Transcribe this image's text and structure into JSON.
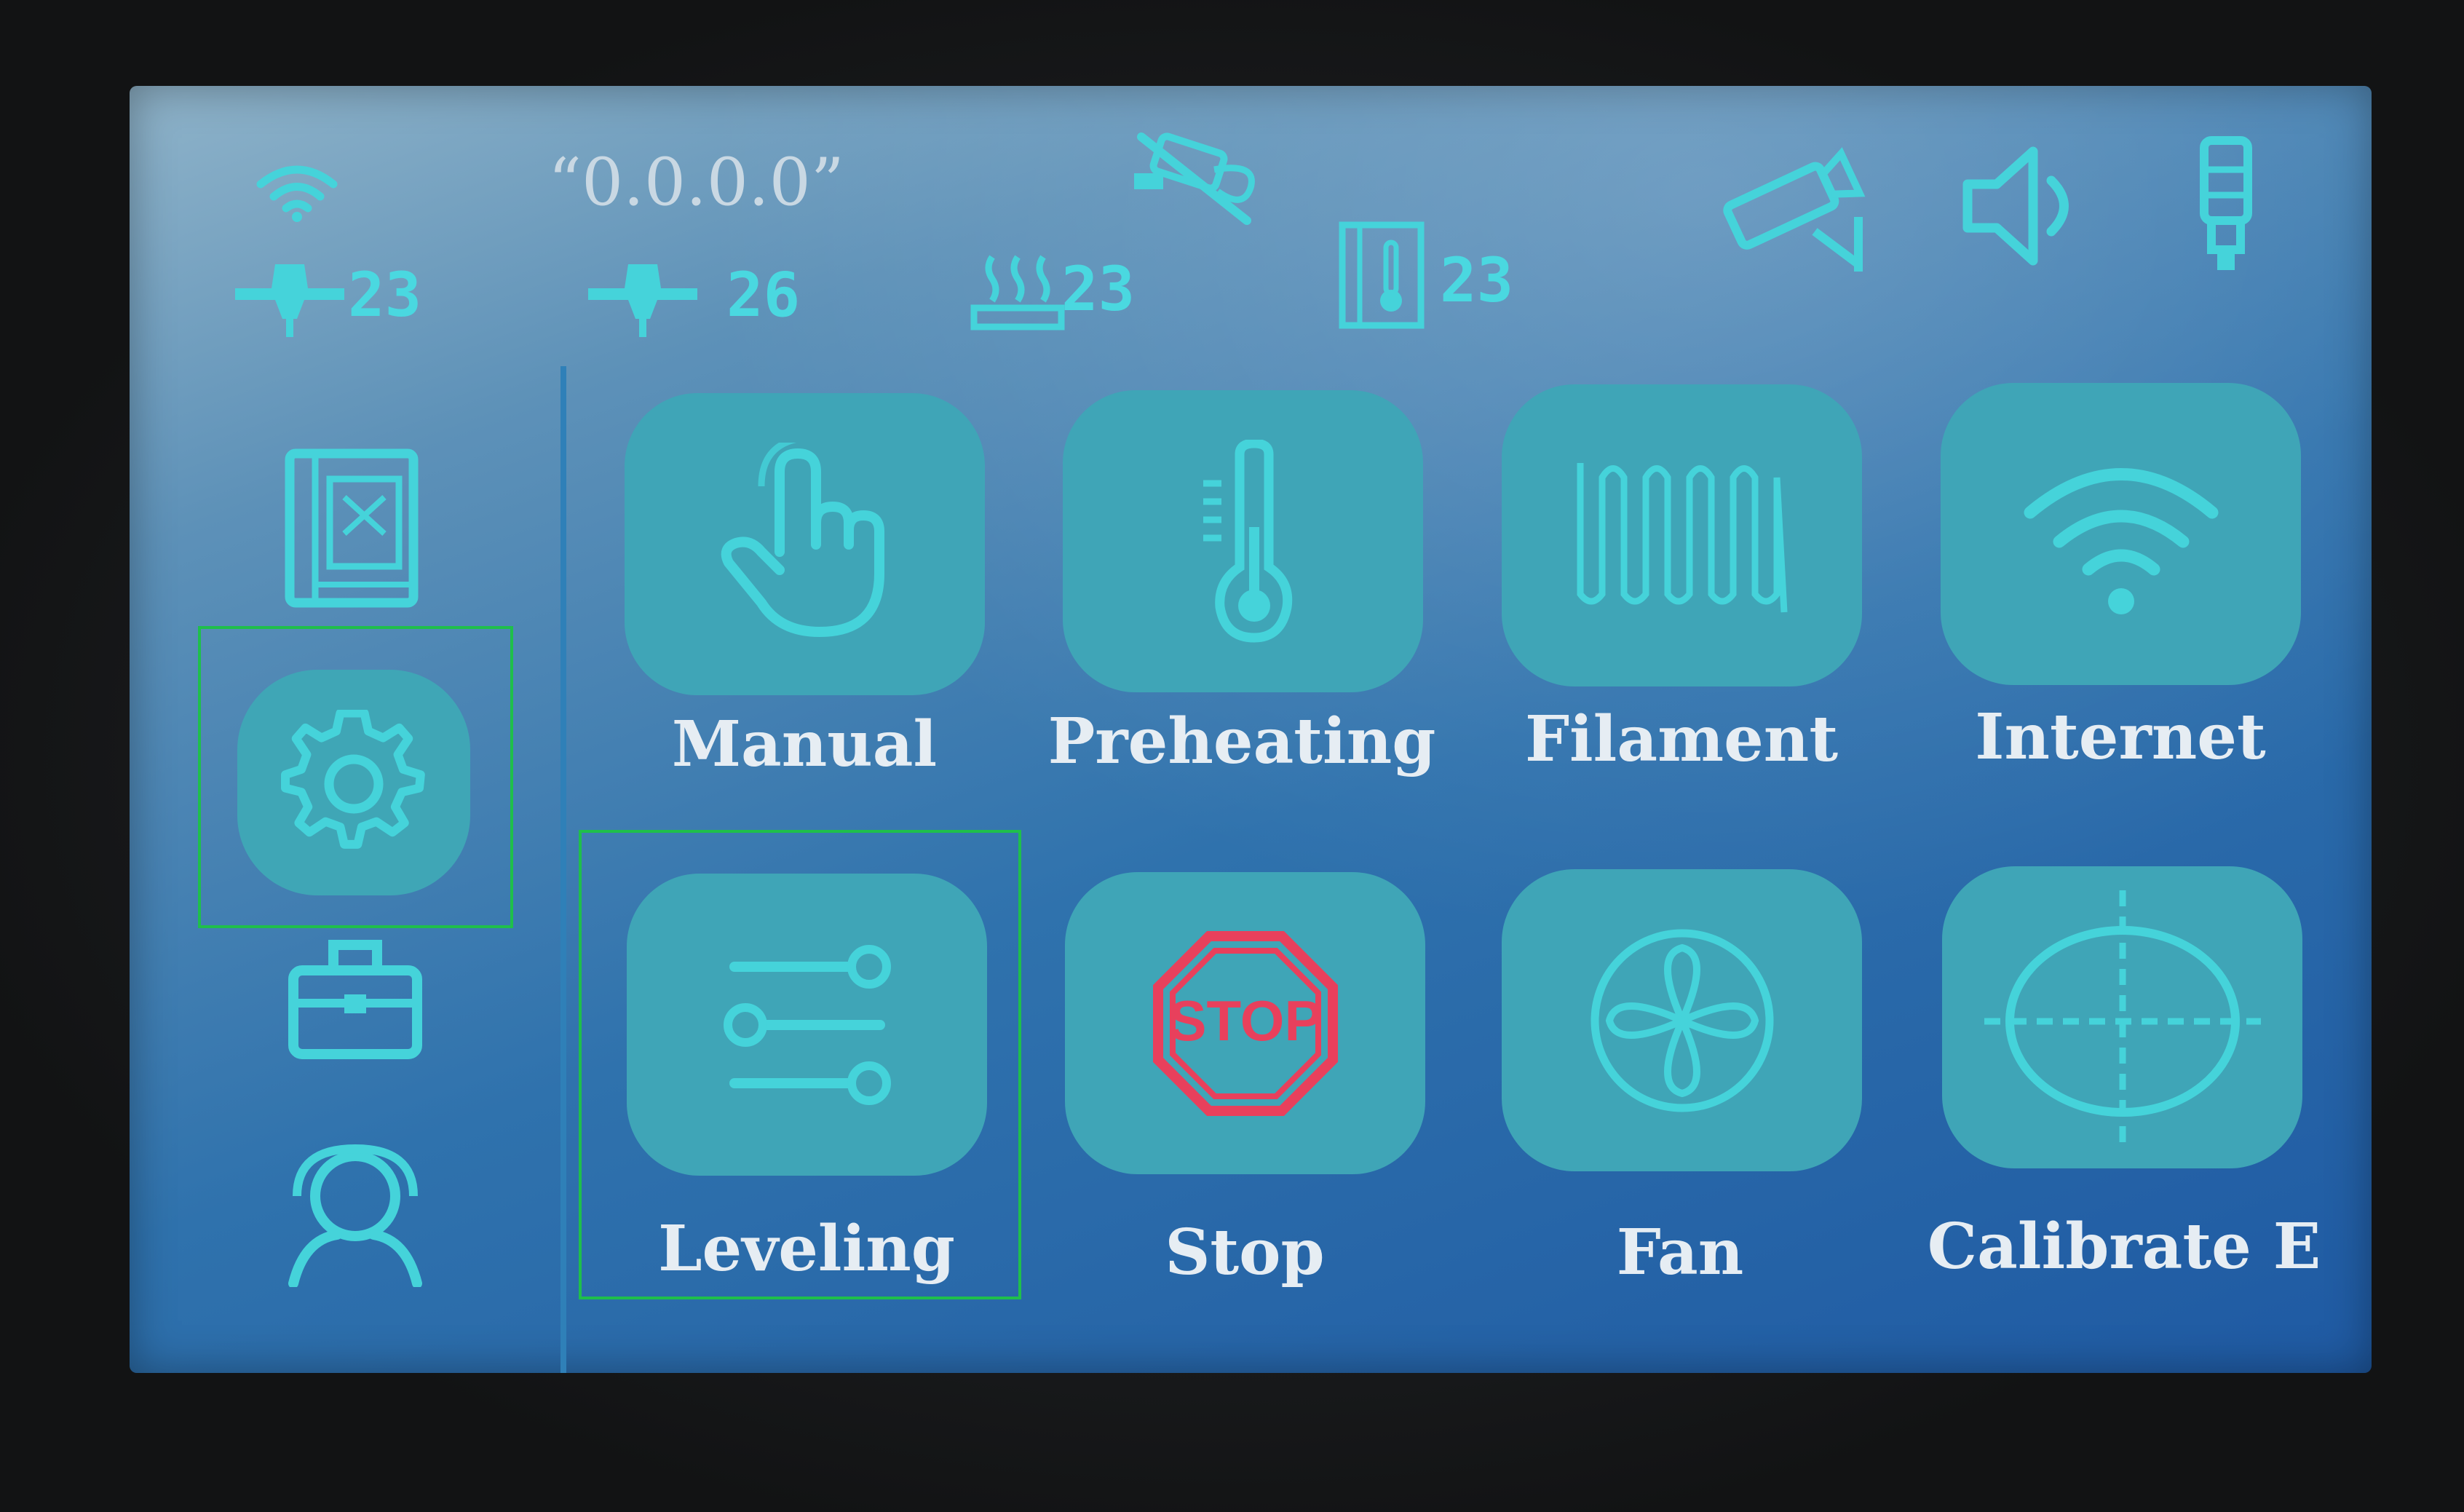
{
  "status_bar": {
    "ip_address": "“0.0.0.0”",
    "nozzle1_temp": "23",
    "nozzle2_temp": "26",
    "bed_temp": "23",
    "chamber_temp": "23"
  },
  "sidebar": {
    "items": [
      {
        "name": "printer-icon"
      },
      {
        "name": "settings-gear-icon",
        "active": true
      },
      {
        "name": "toolbox-icon"
      },
      {
        "name": "support-headset-icon"
      }
    ]
  },
  "grid": {
    "tiles": [
      {
        "label": "Manual",
        "icon": "hand-pointer-icon"
      },
      {
        "label": "Preheating",
        "icon": "thermometer-icon"
      },
      {
        "label": "Filament",
        "icon": "coil-icon"
      },
      {
        "label": "Internet",
        "icon": "wifi-icon"
      },
      {
        "label": "Leveling",
        "icon": "sliders-icon"
      },
      {
        "label": "Stop",
        "icon": "stop-sign-icon"
      },
      {
        "label": "Fan",
        "icon": "fan-icon"
      },
      {
        "label": "Calibrate E",
        "icon": "crosshair-icon"
      }
    ]
  },
  "colors": {
    "icon_cyan": "#45d3da",
    "tile_bg": "#3fa5b7",
    "stop_red": "#e8405c",
    "highlight_green": "#1fbf4b"
  }
}
